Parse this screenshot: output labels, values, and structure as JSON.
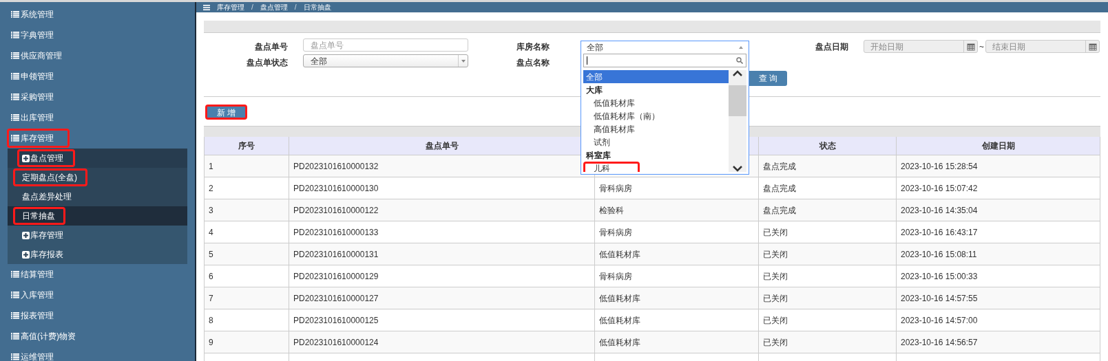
{
  "sidebar": {
    "items": [
      {
        "label": "系统管理",
        "kind": "menu",
        "annotated": false
      },
      {
        "label": "字典管理",
        "kind": "menu",
        "annotated": false
      },
      {
        "label": "供应商管理",
        "kind": "menu",
        "annotated": false
      },
      {
        "label": "申领管理",
        "kind": "menu",
        "annotated": false
      },
      {
        "label": "采购管理",
        "kind": "menu",
        "annotated": false
      },
      {
        "label": "出库管理",
        "kind": "menu",
        "annotated": false
      },
      {
        "label": "库存管理",
        "kind": "menu",
        "annotated": true,
        "expanded": true,
        "children": [
          {
            "label": "盘点管理",
            "kind": "folder",
            "annotated": true,
            "expanded": true,
            "children": [
              {
                "label": "定期盘点(全盘)",
                "kind": "page",
                "annotated": true,
                "selected": false
              },
              {
                "label": "盘点差异处理",
                "kind": "page",
                "annotated": false,
                "selected": false
              },
              {
                "label": "日常抽盘",
                "kind": "page",
                "annotated": true,
                "selected": true
              }
            ]
          },
          {
            "label": "库存管理",
            "kind": "folder",
            "annotated": false,
            "expanded": false
          },
          {
            "label": "库存报表",
            "kind": "folder",
            "annotated": false,
            "expanded": false
          }
        ]
      },
      {
        "label": "结算管理",
        "kind": "menu",
        "annotated": false
      },
      {
        "label": "入库管理",
        "kind": "menu",
        "annotated": false
      },
      {
        "label": "报表管理",
        "kind": "menu",
        "annotated": false
      },
      {
        "label": "高值(计费)物资",
        "kind": "menu",
        "annotated": false
      },
      {
        "label": "运维管理",
        "kind": "menu",
        "annotated": false
      }
    ]
  },
  "breadcrumb": [
    {
      "label": "库存管理",
      "kind": "link"
    },
    {
      "label": "/",
      "kind": "separator"
    },
    {
      "label": "盘点管理",
      "kind": "link"
    },
    {
      "label": "/",
      "kind": "separator"
    },
    {
      "label": "日常抽盘",
      "kind": "current"
    }
  ],
  "filters": {
    "order_no": {
      "label": "盘点单号",
      "placeholder": "盘点单号"
    },
    "order_status": {
      "label": "盘点单状态",
      "value": "全部"
    },
    "warehouse": {
      "label": "库房名称",
      "value": "全部",
      "options": [
        {
          "label": "全部",
          "kind": "option",
          "selected": true,
          "annotated": false
        },
        {
          "label": "大库",
          "kind": "group",
          "annotated": false
        },
        {
          "label": "低值耗材库",
          "kind": "option",
          "selected": false,
          "annotated": false
        },
        {
          "label": "低值耗材库（南）",
          "kind": "option",
          "selected": false,
          "annotated": false
        },
        {
          "label": "高值耗材库",
          "kind": "option",
          "selected": false,
          "annotated": false
        },
        {
          "label": "试剂",
          "kind": "option",
          "selected": false,
          "annotated": false
        },
        {
          "label": "科室库",
          "kind": "group",
          "annotated": false
        },
        {
          "label": "儿科",
          "kind": "option",
          "selected": false,
          "annotated": true
        }
      ]
    },
    "check_name": {
      "label": "盘点名称"
    },
    "date": {
      "label": "盘点日期",
      "start_placeholder": "开始日期",
      "separator": "~",
      "end_placeholder": "结束日期"
    },
    "query_button": "查 询"
  },
  "add_button": {
    "label": "新 增",
    "annotated": true
  },
  "table": {
    "columns": [
      "序号",
      "盘点单号",
      null,
      "状态",
      "创建日期"
    ],
    "rows": [
      [
        "1",
        "PD2023101610000132",
        null,
        "盘点完成",
        "2023-10-16 15:28:54"
      ],
      [
        "2",
        "PD2023101610000130",
        "骨科病房",
        "盘点完成",
        "2023-10-16 15:07:42"
      ],
      [
        "3",
        "PD2023101610000122",
        "检验科",
        "盘点完成",
        "2023-10-16 14:35:04"
      ],
      [
        "4",
        "PD2023101610000133",
        "骨科病房",
        "已关闭",
        "2023-10-16 16:43:17"
      ],
      [
        "5",
        "PD2023101610000131",
        "低值耗材库",
        "已关闭",
        "2023-10-16 15:08:11"
      ],
      [
        "6",
        "PD2023101610000129",
        "骨科病房",
        "已关闭",
        "2023-10-16 15:00:33"
      ],
      [
        "7",
        "PD2023101610000127",
        "低值耗材库",
        "已关闭",
        "2023-10-16 14:57:55"
      ],
      [
        "8",
        "PD2023101610000125",
        "低值耗材库",
        "已关闭",
        "2023-10-16 14:57:00"
      ],
      [
        "9",
        "PD2023101610000124",
        "低值耗材库",
        "已关闭",
        "2023-10-16 14:56:57"
      ]
    ]
  }
}
